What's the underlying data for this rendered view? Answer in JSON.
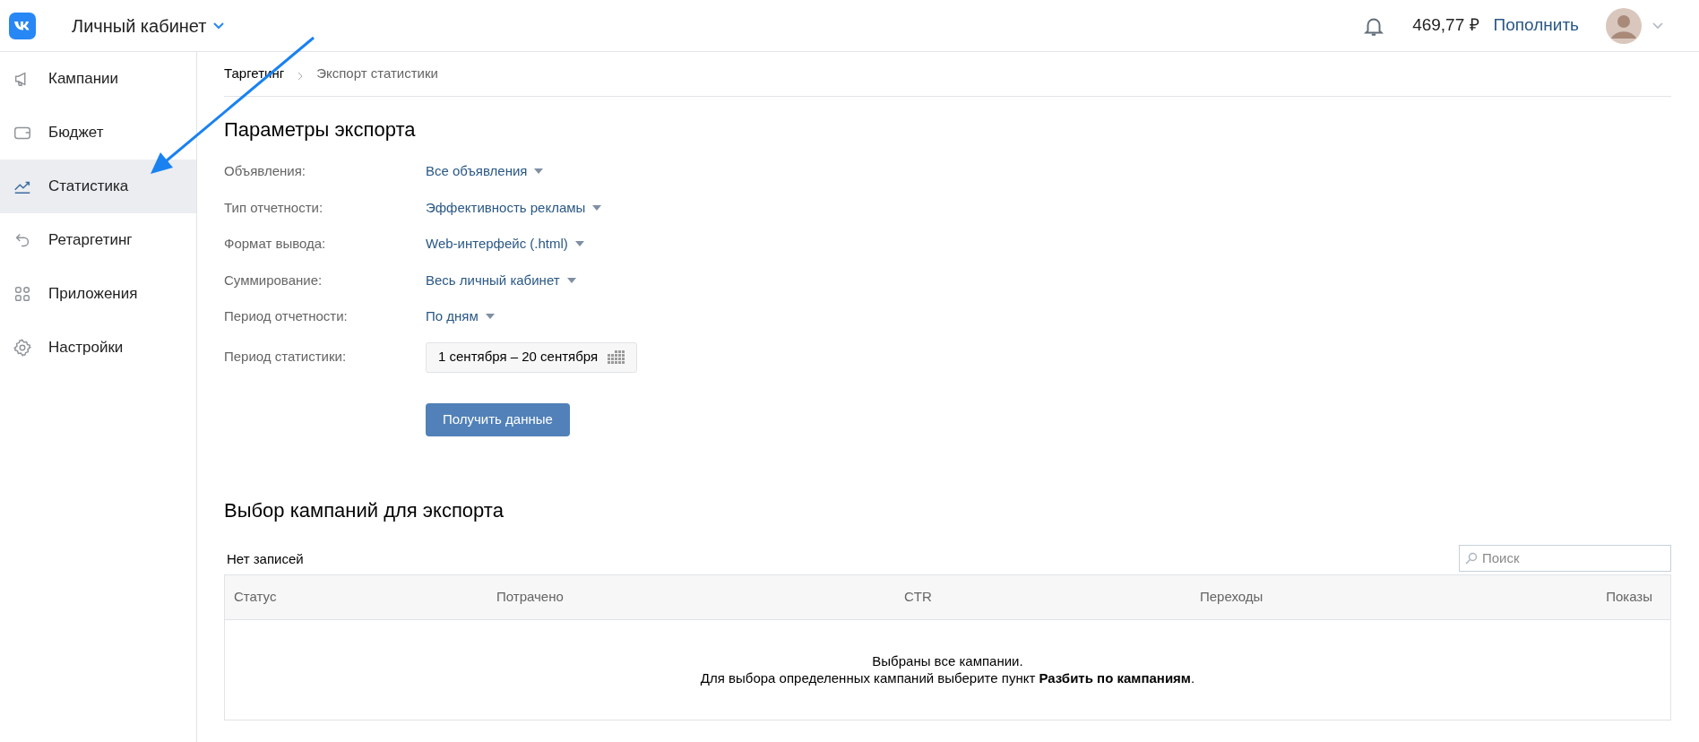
{
  "header": {
    "title": "Личный кабинет",
    "balance": "469,77 ₽",
    "top_up": "Пополнить"
  },
  "sidebar": {
    "items": [
      {
        "kind": "megaphone",
        "label": "Кампании",
        "selected": false
      },
      {
        "kind": "wallet",
        "label": "Бюджет",
        "selected": false
      },
      {
        "kind": "chart",
        "label": "Статистика",
        "selected": true
      },
      {
        "kind": "undo",
        "label": "Ретаргетинг",
        "selected": false
      },
      {
        "kind": "apps",
        "label": "Приложения",
        "selected": false
      },
      {
        "kind": "gear",
        "label": "Настройки",
        "selected": false
      }
    ]
  },
  "breadcrumb": [
    "Таргетинг",
    "Экспорт статистики"
  ],
  "export": {
    "title": "Параметры экспорта",
    "fields": [
      {
        "kind": "dropdown",
        "label": "Объявления:",
        "value": "Все объявления"
      },
      {
        "kind": "dropdown",
        "label": "Тип отчетности:",
        "value": "Эффективность рекламы"
      },
      {
        "kind": "dropdown",
        "label": "Формат вывода:",
        "value": "Web-интерфейс (.html)"
      },
      {
        "kind": "dropdown",
        "label": "Суммирование:",
        "value": "Весь личный кабинет"
      },
      {
        "kind": "dropdown",
        "label": "Период отчетности:",
        "value": "По дням"
      },
      {
        "kind": "date",
        "label": "Период статистики:",
        "value": "1 сентября – 20 сентября"
      }
    ],
    "button": "Получить данные"
  },
  "campaigns": {
    "title": "Выбор кампаний для экспорта",
    "count": "Нет записей",
    "search": {
      "placeholder": "Поиск"
    },
    "columns": [
      "Статус",
      "Потрачено",
      "CTR",
      "Переходы",
      "Показы"
    ],
    "empty_line_1": "Выбраны все кампании.",
    "empty_line_2": "Для выбора определенных кампаний выберите пункт **Разбить по кампаниям**."
  }
}
